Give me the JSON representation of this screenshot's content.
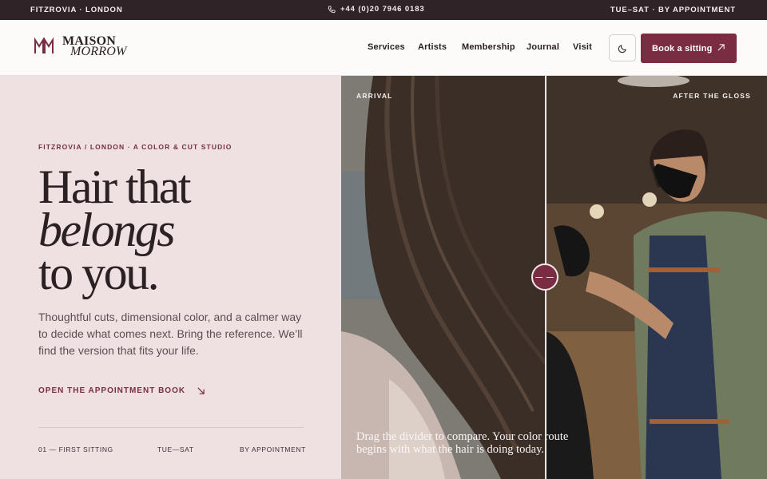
{
  "topbar": {
    "location": "FITZROVIA · LONDON",
    "phone": "+44 (0)20 7946 0183",
    "hours": "TUE–SAT · BY APPOINTMENT"
  },
  "brand": {
    "line1": "MAISON",
    "line2": "MORROW"
  },
  "nav": {
    "items": [
      "Services",
      "Artists",
      "Membership",
      "Journal",
      "Visit"
    ],
    "book_label": "Book a sitting"
  },
  "hero": {
    "eyebrow": "FITZROVIA / LONDON · A COLOR & CUT STUDIO",
    "headline_line1": "Hair that",
    "headline_line2": "belongs",
    "headline_line3": "to you.",
    "lede": "Thoughtful cuts, dimensional color, and a calmer way to decide what comes next. Bring the reference. We’ll find the version that fits your life.",
    "cta_label": "OPEN THE APPOINTMENT BOOK",
    "meta": [
      "01 — FIRST SITTING",
      "TUE—SAT",
      "BY APPOINTMENT"
    ]
  },
  "compare": {
    "before_label": "ARRIVAL",
    "after_label": "AFTER THE GLOSS",
    "handle_glyph": "— —",
    "caption": "Drag the divider to compare. Your color route begins with what the hair is doing today.",
    "divider_position": 0.48
  },
  "colors": {
    "accent": "#7a2c43",
    "topbar_bg": "#2f2328",
    "hero_bg": "#efe1e2"
  }
}
